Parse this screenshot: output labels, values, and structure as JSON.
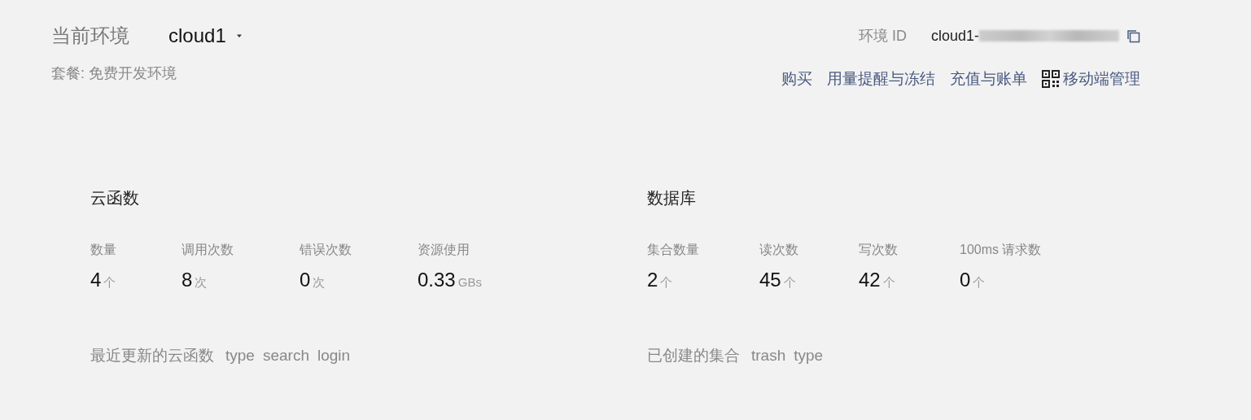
{
  "environment": {
    "label": "当前环境",
    "name": "cloud1",
    "plan": "套餐: 免费开发环境",
    "id_label": "环境 ID",
    "id_prefix": "cloud1-"
  },
  "links": [
    {
      "label": "购买",
      "kind": "text"
    },
    {
      "label": "用量提醒与冻结",
      "kind": "text"
    },
    {
      "label": "充值与账单",
      "kind": "text"
    },
    {
      "label": "移动端管理",
      "kind": "qr"
    }
  ],
  "sections": [
    {
      "title": "云函数",
      "stats": [
        {
          "label": "数量",
          "value": "4",
          "unit": "个"
        },
        {
          "label": "调用次数",
          "value": "8",
          "unit": "次"
        },
        {
          "label": "错误次数",
          "value": "0",
          "unit": "次"
        },
        {
          "label": "资源使用",
          "value": "0.33",
          "unit": "GBs"
        }
      ],
      "recent_label": "最近更新的云函数",
      "recent_items": [
        "type",
        "search",
        "login"
      ]
    },
    {
      "title": "数据库",
      "stats": [
        {
          "label": "集合数量",
          "value": "2",
          "unit": "个"
        },
        {
          "label": "读次数",
          "value": "45",
          "unit": "个"
        },
        {
          "label": "写次数",
          "value": "42",
          "unit": "个"
        },
        {
          "label": "100ms 请求数",
          "value": "0",
          "unit": "个"
        }
      ],
      "recent_label": "已创建的集合",
      "recent_items": [
        "trash",
        "type"
      ]
    }
  ]
}
